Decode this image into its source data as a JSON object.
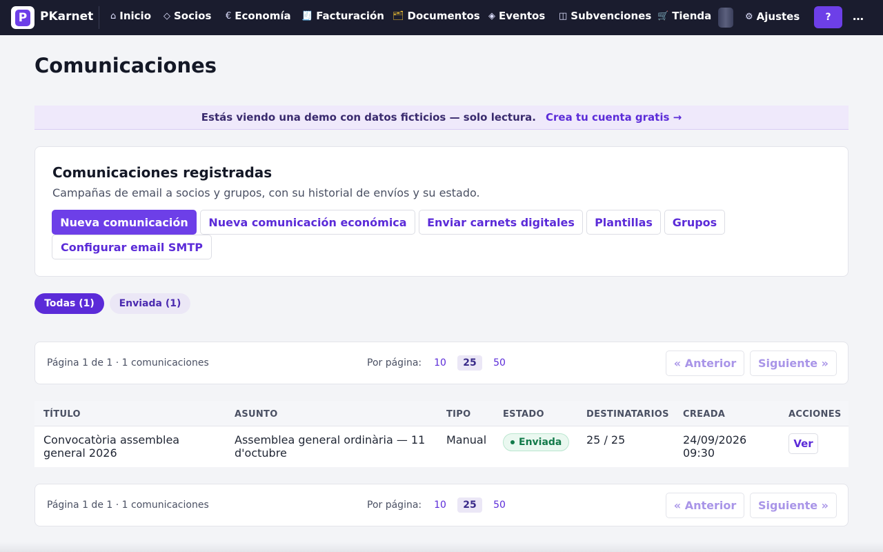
{
  "topbar": {
    "brand": "PKarnet",
    "logo_letter": "P",
    "nav": [
      {
        "icon": "home-icon",
        "glyph": "⌂",
        "label": "Inicio"
      },
      {
        "icon": "diamond-icon",
        "glyph": "◇",
        "label": "Socios"
      },
      {
        "icon": "euro-icon",
        "glyph": "€",
        "label": "Economía"
      },
      {
        "icon": "receipt-icon",
        "glyph": "🧾",
        "label": "Facturación"
      },
      {
        "icon": "folder-icon",
        "glyph": "🗂",
        "label": "Documentos"
      },
      {
        "icon": "event-icon",
        "glyph": "◈",
        "label": "Eventos"
      },
      {
        "icon": "grants-icon",
        "glyph": "◫",
        "label": "Subvenciones"
      },
      {
        "icon": "cart-icon",
        "glyph": "🛒",
        "label": "Tienda"
      }
    ],
    "settings": {
      "icon": "gear-icon",
      "glyph": "⚙",
      "label": "Ajustes"
    },
    "help_label": "?",
    "more_label": "…"
  },
  "page": {
    "title": "Comunicaciones"
  },
  "demo_banner": {
    "text": "Estás viendo una demo con datos ficticios — solo lectura.",
    "link": "Crea tu cuenta gratis →"
  },
  "card": {
    "title": "Comunicaciones registradas",
    "description": "Campañas de email a socios y grupos, con su historial de envíos y su estado.",
    "buttons": [
      "Nueva comunicación",
      "Nueva comunicación económica",
      "Enviar carnets digitales",
      "Plantillas",
      "Grupos",
      "Configurar email SMTP"
    ]
  },
  "filters": {
    "all": "Todas (1)",
    "sent": "Enviada (1)"
  },
  "pager": {
    "info": "Página 1 de 1 · 1 comunicaciones",
    "per_page_label": "Por página:",
    "per_page_options": [
      "10",
      "25",
      "50"
    ],
    "selected": "25",
    "prev": "« Anterior",
    "next": "Siguiente »"
  },
  "table": {
    "headers": [
      "TÍTULO",
      "ASUNTO",
      "TIPO",
      "ESTADO",
      "DESTINATARIOS",
      "CREADA",
      "ACCIONES"
    ],
    "rows": [
      {
        "title_line1": "Convocatòria assemblea",
        "title_line2": "general 2026",
        "subject_line1": "Assemblea general ordinària — 11",
        "subject_line2": "d'octubre",
        "type": "Manual",
        "status": "Enviada",
        "recipients": "25 / 25",
        "created_date": "24/09/2026",
        "created_time": "09:30",
        "action": "Ver"
      }
    ]
  }
}
